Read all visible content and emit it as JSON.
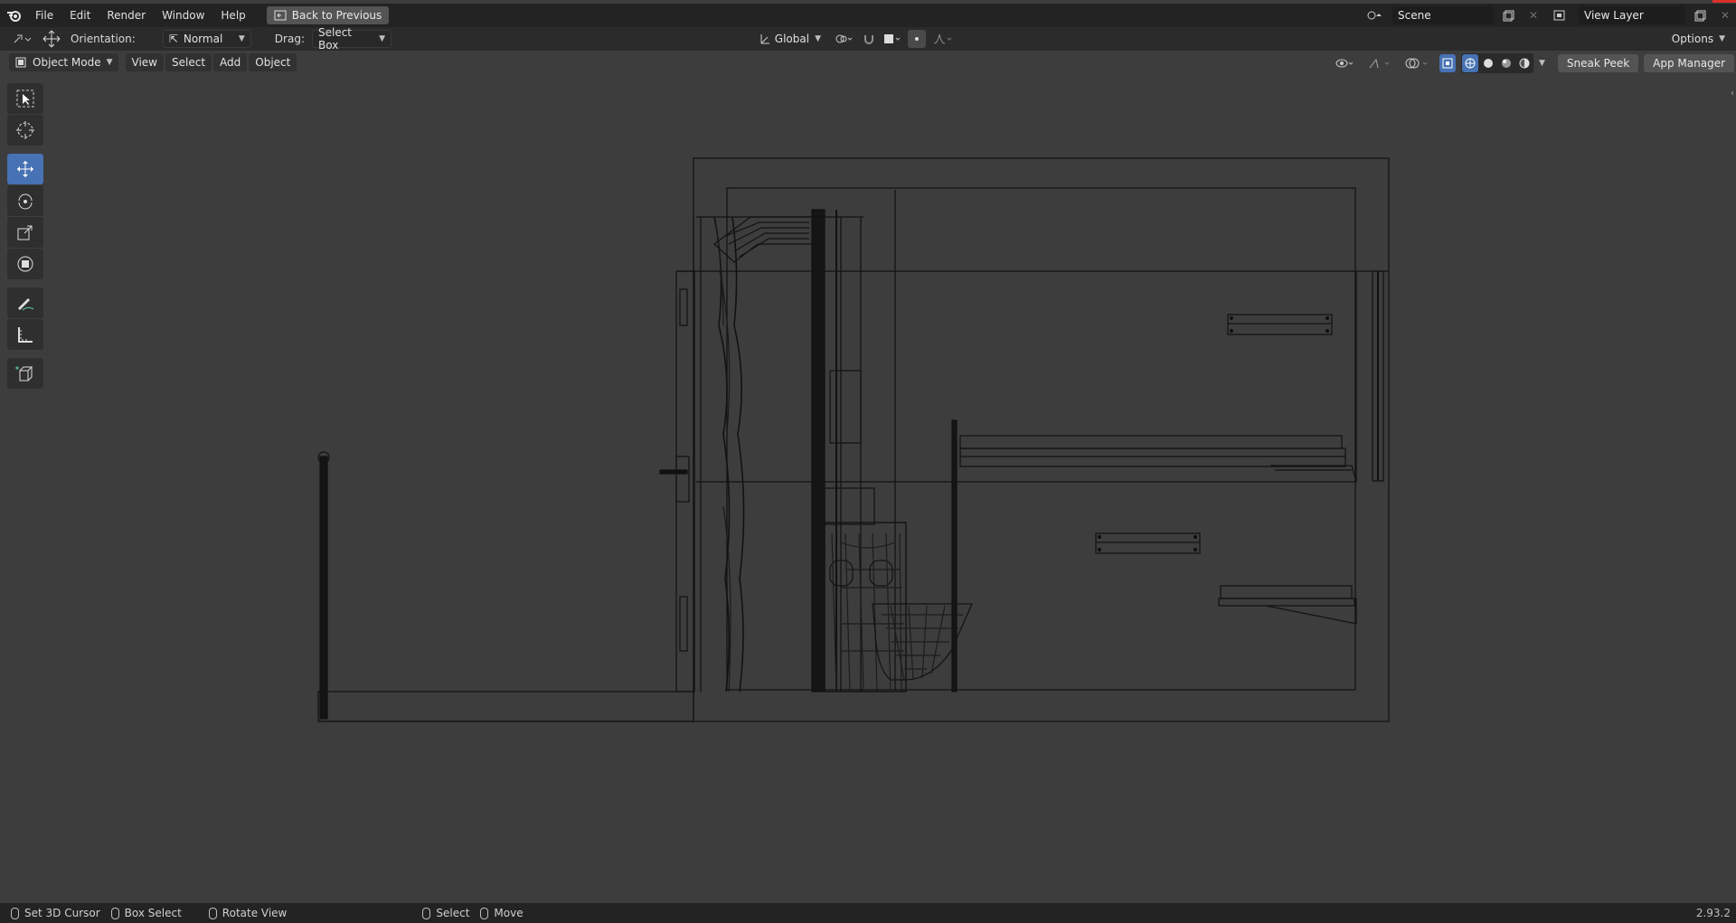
{
  "menu": {
    "items": [
      "File",
      "Edit",
      "Render",
      "Window",
      "Help"
    ],
    "back_button": "Back to Previous"
  },
  "scene": {
    "scene_name": "Scene",
    "view_layer": "View Layer"
  },
  "tool_header": {
    "orientation_label": "Orientation:",
    "orientation_value": "Normal",
    "drag_label": "Drag:",
    "drag_value": "Select Box",
    "transform_orientation": "Global",
    "options": "Options"
  },
  "view_header": {
    "mode": "Object Mode",
    "menus": [
      "View",
      "Select",
      "Add",
      "Object"
    ],
    "sneak_peek": "Sneak Peek",
    "app_manager": "App Manager"
  },
  "toolbar": {
    "tools": [
      "select-box-icon",
      "cursor-icon",
      "move-icon",
      "rotate-icon",
      "scale-icon",
      "transform-icon",
      "annotate-icon",
      "measure-icon",
      "add-cube-icon"
    ],
    "active_tool": "move-icon"
  },
  "status": {
    "set_cursor": "Set 3D Cursor",
    "box_select": "Box Select",
    "rotate_view": "Rotate View",
    "select": "Select",
    "move": "Move",
    "version": "2.93.2"
  },
  "colors": {
    "accent": "#4772b3",
    "viewport_bg": "#3d3d3d",
    "wire": "#121212"
  }
}
